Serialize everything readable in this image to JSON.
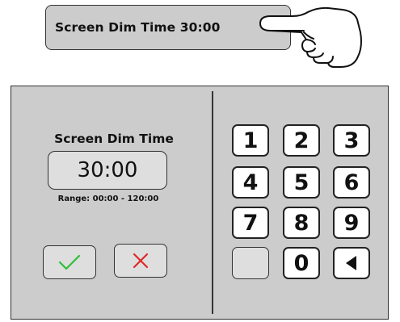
{
  "setting_bar": {
    "label": "Screen Dim Time 30:00"
  },
  "dialog": {
    "title": "Screen Dim Time",
    "value": "30:00",
    "range": "Range: 00:00 - 120:00"
  },
  "keypad": {
    "keys": [
      "1",
      "2",
      "3",
      "4",
      "5",
      "6",
      "7",
      "8",
      "9",
      "",
      "0"
    ]
  },
  "colors": {
    "confirm": "#2dbf3a",
    "cancel": "#e02828",
    "panel": "#cccccc",
    "field": "#dedede"
  },
  "icons": {
    "pointer": "pointing-hand-icon",
    "confirm": "checkmark-icon",
    "cancel": "x-icon",
    "backspace": "left-triangle-icon"
  }
}
